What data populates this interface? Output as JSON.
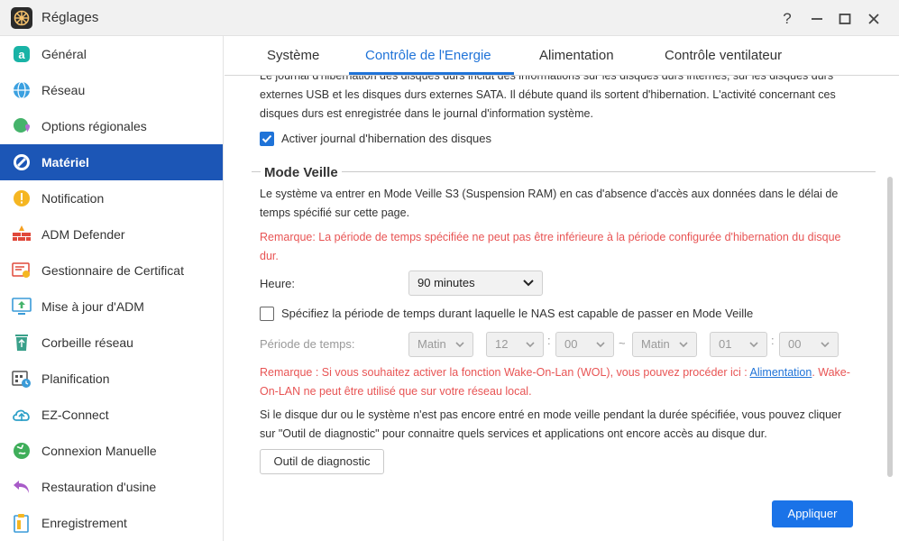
{
  "window": {
    "title": "Réglages",
    "controls": {
      "help": "?",
      "minimize": "—",
      "maximize": "▢",
      "close": "✕"
    }
  },
  "sidebar": {
    "items": [
      {
        "label": "Général",
        "icon": "general-icon",
        "active": false
      },
      {
        "label": "Réseau",
        "icon": "network-icon",
        "active": false
      },
      {
        "label": "Options régionales",
        "icon": "regional-options-icon",
        "active": false
      },
      {
        "label": "Matériel",
        "icon": "hardware-icon",
        "active": true
      },
      {
        "label": "Notification",
        "icon": "notification-icon",
        "active": false
      },
      {
        "label": "ADM Defender",
        "icon": "firewall-icon",
        "active": false
      },
      {
        "label": "Gestionnaire de Certificat",
        "icon": "certificate-icon",
        "active": false
      },
      {
        "label": "Mise à jour d'ADM",
        "icon": "update-icon",
        "active": false
      },
      {
        "label": "Corbeille réseau",
        "icon": "recycle-bin-icon",
        "active": false
      },
      {
        "label": "Planification",
        "icon": "schedule-icon",
        "active": false
      },
      {
        "label": "EZ-Connect",
        "icon": "cloud-icon",
        "active": false
      },
      {
        "label": "Connexion Manuelle",
        "icon": "globe-icon",
        "active": false
      },
      {
        "label": "Restauration d'usine",
        "icon": "undo-icon",
        "active": false
      },
      {
        "label": "Enregistrement",
        "icon": "clipboard-icon",
        "active": false
      }
    ]
  },
  "tabs": [
    {
      "label": "Système",
      "active": false
    },
    {
      "label": "Contrôle de l'Energie",
      "active": true
    },
    {
      "label": "Alimentation",
      "active": false
    },
    {
      "label": "Contrôle ventilateur",
      "active": false
    }
  ],
  "hibernation": {
    "text_line1": "Le journal d'hibernation des disques durs inclut des informations sur les disques durs internes, sur les disques durs",
    "text_line2": "externes USB et les disques durs externes SATA.  Il débute quand ils sortent d'hibernation. L'activité concernant ces",
    "text_line3": "disques durs est enregistrée dans le journal d'information système.",
    "checkbox_label": "Activer journal d'hibernation des disques",
    "checked": true
  },
  "sleep": {
    "section_title": "Mode Veille",
    "desc_line1": "Le système va entrer en Mode Veille S3 (Suspension RAM) en cas d'absence d'accès aux données dans le délai de",
    "desc_line2": "temps spécifié sur cette page.",
    "warning_line1": "Remarque: La période de temps spécifiée ne peut pas être inférieure à la période configurée d'hibernation du disque",
    "warning_line2": "dur.",
    "hour_label": "Heure:",
    "hour_value": "90 minutes",
    "period_checkbox_label": "Spécifiez la période de temps durant laquelle le NAS est capable de passer en Mode Veille",
    "period_checked": false,
    "period_label": "Période de temps:",
    "start": {
      "ampm": "Matin",
      "hour": "12",
      "minute": "00"
    },
    "end": {
      "ampm": "Matin",
      "hour": "01",
      "minute": "00"
    },
    "colon": ":",
    "tilde": "~",
    "wol_warning_pre": "Remarque : Si vous souhaitez activer la fonction Wake-On-Lan (WOL), vous pouvez procéder ici : ",
    "wol_link": "Alimentation",
    "wol_warning_post": ". Wake-",
    "wol_warning_line2": "On-LAN ne peut être utilisé que sur votre réseau local.",
    "diag_line1": "Si le disque dur ou le système n'est pas encore entré en mode veille pendant la durée spécifiée, vous pouvez cliquer",
    "diag_line2": "sur \"Outil de diagnostic\" pour connaitre quels services et applications ont encore accès au disque dur.",
    "diag_button": "Outil de diagnostic"
  },
  "apply_button": "Appliquer",
  "colors": {
    "accent": "#1f73d8",
    "sidebar_active": "#1c56b6",
    "warning": "#e85454"
  }
}
